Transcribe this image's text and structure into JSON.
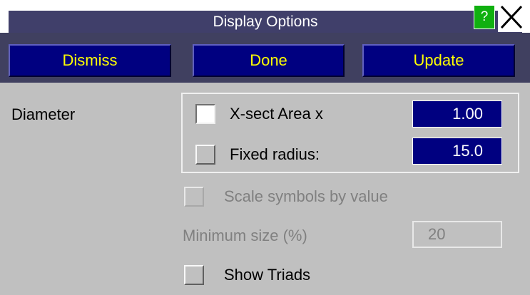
{
  "window": {
    "title": "Display Options",
    "help_label": "?",
    "close_icon": "close-x-icon"
  },
  "toolbar": {
    "dismiss_label": "Dismiss",
    "done_label": "Done",
    "update_label": "Update"
  },
  "diameter": {
    "label": "Diameter",
    "xsect": {
      "label": "X-sect Area x",
      "value": "1.00",
      "checked": false
    },
    "fixed": {
      "label": "Fixed radius:",
      "value": "15.0",
      "checked": false
    }
  },
  "scale_symbols": {
    "label": "Scale symbols by value",
    "enabled": false,
    "checked": false
  },
  "minimum_size": {
    "label": "Minimum size (%)",
    "value": "20",
    "enabled": false
  },
  "show_triads": {
    "label": "Show Triads",
    "checked": false
  },
  "colors": {
    "title_bar": "#403f6a",
    "button_bg": "#000080",
    "button_text": "#ffff00",
    "help_bg": "#10b010",
    "panel_bg": "#c0c0c0"
  }
}
